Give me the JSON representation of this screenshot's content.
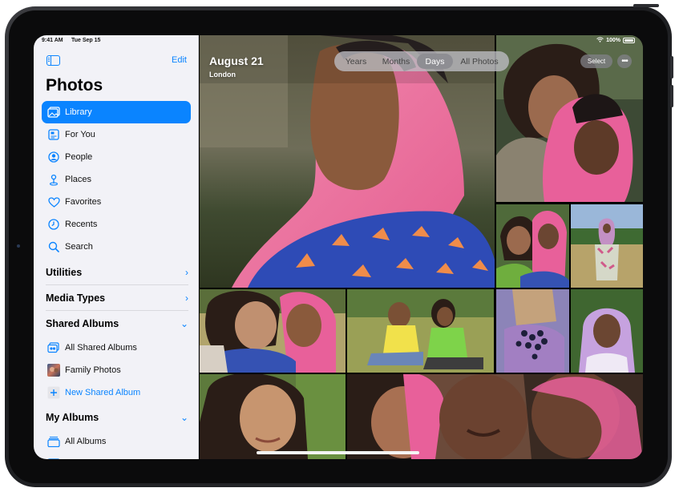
{
  "status_bar": {
    "time": "9:41 AM",
    "date": "Tue Sep 15",
    "battery": "100%"
  },
  "sidebar": {
    "edit_label": "Edit",
    "title": "Photos",
    "items": [
      {
        "label": "Library",
        "icon": "library-icon",
        "active": true
      },
      {
        "label": "For You",
        "icon": "for-you-icon"
      },
      {
        "label": "People",
        "icon": "people-icon"
      },
      {
        "label": "Places",
        "icon": "places-icon"
      },
      {
        "label": "Favorites",
        "icon": "heart-icon"
      },
      {
        "label": "Recents",
        "icon": "clock-icon"
      },
      {
        "label": "Search",
        "icon": "search-icon"
      }
    ],
    "sections": {
      "utilities": "Utilities",
      "media_types": "Media Types",
      "shared_albums": "Shared Albums",
      "my_albums": "My Albums"
    },
    "shared_album_items": [
      {
        "label": "All Shared Albums",
        "icon": "shared-albums-icon"
      },
      {
        "label": "Family Photos",
        "icon": "album-thumbnail-icon"
      },
      {
        "label": "New Shared Album",
        "icon": "plus-icon"
      }
    ],
    "my_album_items": [
      {
        "label": "All Albums",
        "icon": "albums-stack-icon"
      }
    ]
  },
  "header": {
    "date": "August 21",
    "location": "London",
    "segments": [
      "Years",
      "Months",
      "Days",
      "All Photos"
    ],
    "active_segment": "Days",
    "select_label": "Select",
    "more_label": "•••"
  },
  "colors": {
    "accent": "#0a84ff",
    "sidebar_bg": "#f2f2f7"
  }
}
